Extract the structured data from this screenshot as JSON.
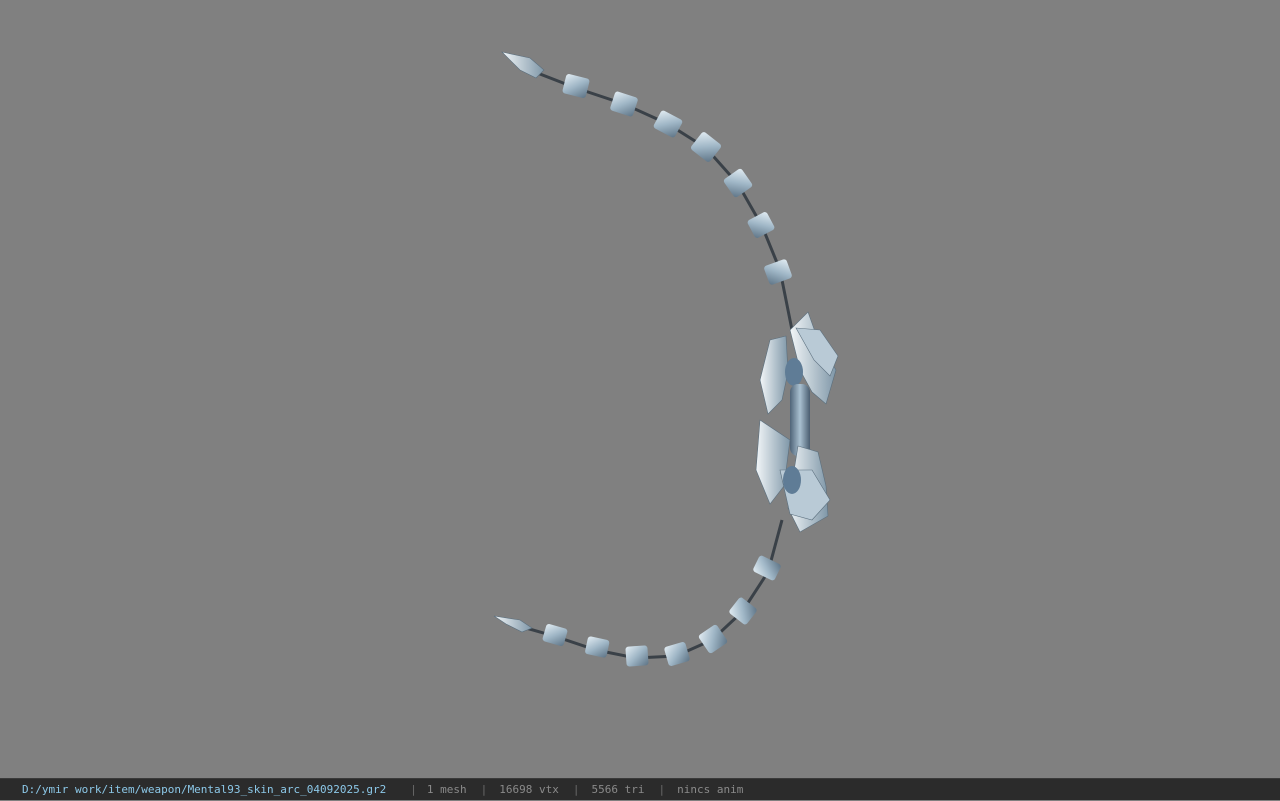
{
  "viewer": {
    "background_color": "#808080",
    "model_name": "bow-weapon-model"
  },
  "status_bar": {
    "file_path": "D:/ymir work/item/weapon/Mental93_skin_arc_04092025.gr2",
    "separator": "|",
    "mesh_count": "1 mesh",
    "vertex_count": "16698 vtx",
    "triangle_count": "5566 tri",
    "anim_status": "nincs anim",
    "path_color": "#8cc8e8",
    "text_color": "#8a8a8a",
    "bar_color": "#2b2b2b"
  }
}
